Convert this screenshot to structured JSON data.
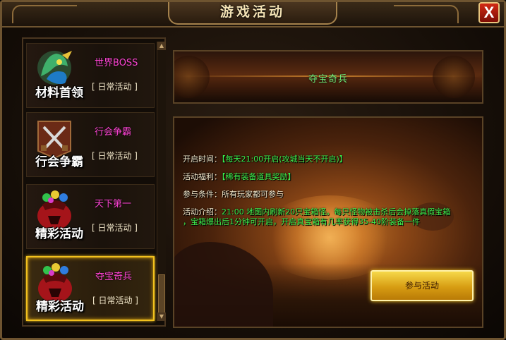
{
  "window": {
    "title": "游戏活动",
    "close_label": "X"
  },
  "activities": [
    {
      "icon_caption": "材料首领",
      "name": "世界BOSS",
      "tag": "[ 日常活动 ]",
      "icon": "boss-dragon-icon",
      "selected": false
    },
    {
      "icon_caption": "行会争霸",
      "name": "行会争霸",
      "tag": "[ 日常活动 ]",
      "icon": "crossed-swords-banner-icon",
      "selected": false
    },
    {
      "icon_caption": "精彩活动",
      "name": "天下第一",
      "tag": "[ 日常活动 ]",
      "icon": "treasure-bag-icon",
      "selected": false
    },
    {
      "icon_caption": "精彩活动",
      "name": "夺宝奇兵",
      "tag": "[ 日常活动 ]",
      "icon": "treasure-bag-icon",
      "selected": true
    }
  ],
  "detail": {
    "banner_title": "夺宝奇兵",
    "open_time_label": "开启时间：",
    "open_time_value": "【每天21:00开启(攻城当天不开启)】",
    "reward_label": "活动福利：",
    "reward_value": "【稀有装备道具奖励】",
    "condition_label": "参与条件：",
    "condition_value": "所有玩家都可参与",
    "intro_label": "活动介绍：",
    "intro_text_1": "21:00 地图内刷新20只宝箱怪。每只怪物被击杀后会掉落真假宝箱",
    "intro_text_2": "，宝箱爆出后1分钟可开启，开启真宝箱有几率获得35-40阶装备一件",
    "join_button": "参与活动"
  },
  "colors": {
    "activity_name": "#ff44d5",
    "highlight_green": "#3df04d",
    "selected_border": "#f2c11e",
    "close_button": "#d22a14"
  }
}
